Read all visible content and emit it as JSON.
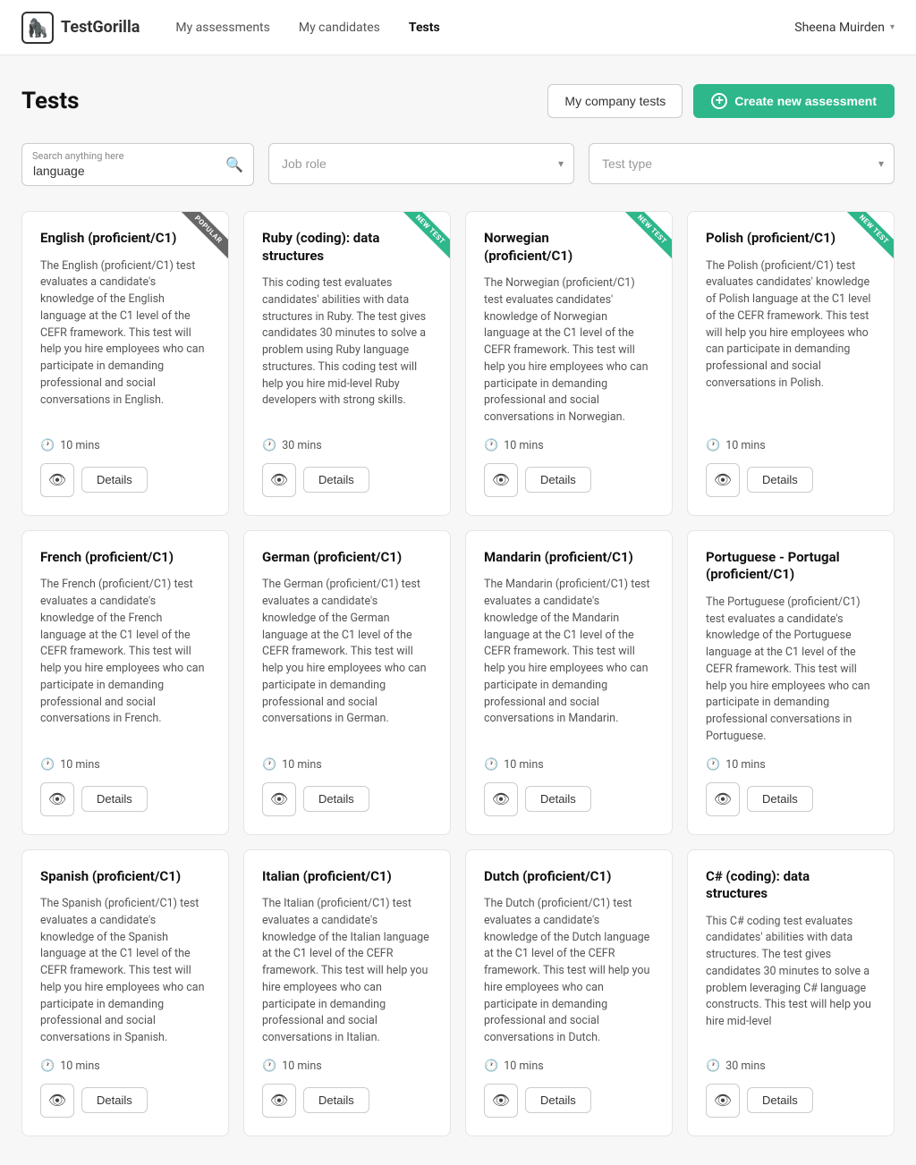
{
  "header": {
    "logo_text": "TestGorilla",
    "nav_items": [
      {
        "label": "My assessments",
        "active": false
      },
      {
        "label": "My candidates",
        "active": false
      },
      {
        "label": "Tests",
        "active": true
      }
    ],
    "user_name": "Sheena Muirden"
  },
  "page": {
    "title": "Tests",
    "btn_company_tests": "My company tests",
    "btn_create": "Create new assessment"
  },
  "filters": {
    "search_label": "Search anything here",
    "search_value": "language",
    "job_role_placeholder": "Job role",
    "test_type_placeholder": "Test type"
  },
  "cards": [
    {
      "title": "English (proficient/C1)",
      "desc": "The English (proficient/C1) test evaluates a candidate's knowledge of the English language at the C1 level of the CEFR framework. This test will help you hire employees who can participate in demanding professional and social conversations in English.",
      "duration": "10 mins",
      "badge": "POPULAR",
      "badge_type": "popular"
    },
    {
      "title": "Ruby (coding): data structures",
      "desc": "This coding test evaluates candidates' abilities with data structures in Ruby. The test gives candidates 30 minutes to solve a problem using Ruby language structures. This coding test will help you hire mid-level Ruby developers with strong skills.",
      "duration": "30 mins",
      "badge": "NEW TEST",
      "badge_type": "new"
    },
    {
      "title": "Norwegian (proficient/C1)",
      "desc": "The Norwegian (proficient/C1) test evaluates candidates' knowledge of Norwegian language at the C1 level of the CEFR framework. This test will help you hire employees who can participate in demanding professional and social conversations in Norwegian.",
      "duration": "10 mins",
      "badge": "NEW TEST",
      "badge_type": "new"
    },
    {
      "title": "Polish (proficient/C1)",
      "desc": "The Polish (proficient/C1) test evaluates candidates' knowledge of Polish language at the C1 level of the CEFR framework. This test will help you hire employees who can participate in demanding professional and social conversations in Polish.",
      "duration": "10 mins",
      "badge": "NEW TEST",
      "badge_type": "new"
    },
    {
      "title": "French (proficient/C1)",
      "desc": "The French (proficient/C1) test evaluates a candidate's knowledge of the French language at the C1 level of the CEFR framework. This test will help you hire employees who can participate in demanding professional and social conversations in French.",
      "duration": "10 mins",
      "badge": null,
      "badge_type": null
    },
    {
      "title": "German (proficient/C1)",
      "desc": "The German (proficient/C1) test evaluates a candidate's knowledge of the German language at the C1 level of the CEFR framework. This test will help you hire employees who can participate in demanding professional and social conversations in German.",
      "duration": "10 mins",
      "badge": null,
      "badge_type": null
    },
    {
      "title": "Mandarin (proficient/C1)",
      "desc": "The Mandarin (proficient/C1) test evaluates a candidate's knowledge of the Mandarin language at the C1 level of the CEFR framework. This test will help you hire employees who can participate in demanding professional and social conversations in Mandarin.",
      "duration": "10 mins",
      "badge": null,
      "badge_type": null
    },
    {
      "title": "Portuguese - Portugal (proficient/C1)",
      "desc": "The Portuguese (proficient/C1) test evaluates a candidate's knowledge of the Portuguese language at the C1 level of the CEFR framework. This test will help you hire employees who can participate in demanding professional conversations in Portuguese.",
      "duration": "10 mins",
      "badge": null,
      "badge_type": null
    },
    {
      "title": "Spanish (proficient/C1)",
      "desc": "The Spanish (proficient/C1) test evaluates a candidate's knowledge of the Spanish language at the C1 level of the CEFR framework. This test will help you hire employees who can participate in demanding professional and social conversations in Spanish.",
      "duration": "10 mins",
      "badge": null,
      "badge_type": null
    },
    {
      "title": "Italian (proficient/C1)",
      "desc": "The Italian (proficient/C1) test evaluates a candidate's knowledge of the Italian language at the C1 level of the CEFR framework. This test will help you hire employees who can participate in demanding professional and social conversations in Italian.",
      "duration": "10 mins",
      "badge": null,
      "badge_type": null
    },
    {
      "title": "Dutch (proficient/C1)",
      "desc": "The Dutch (proficient/C1) test evaluates a candidate's knowledge of the Dutch language at the C1 level of the CEFR framework. This test will help you hire employees who can participate in demanding professional and social conversations in Dutch.",
      "duration": "10 mins",
      "badge": null,
      "badge_type": null
    },
    {
      "title": "C# (coding): data structures",
      "desc": "This C# coding test evaluates candidates' abilities with data structures. The test gives candidates 30 minutes to solve a problem leveraging C# language constructs. This test will help you hire mid-level",
      "duration": "30 mins",
      "badge": null,
      "badge_type": null
    }
  ],
  "ui": {
    "details_label": "Details",
    "eye_icon": "👁",
    "clock_icon": "🕐",
    "plus_icon": "+",
    "search_icon": "🔍",
    "chevron_icon": "▾"
  }
}
